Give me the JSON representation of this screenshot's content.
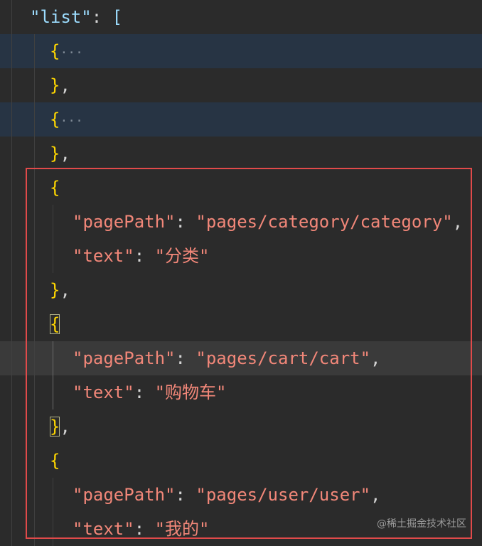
{
  "lines": {
    "l0": {
      "key": "\"list\"",
      "colon": ": ",
      "bracket": "["
    },
    "l1": {
      "brace": "{",
      "ellipsis": "···"
    },
    "l2": {
      "brace": "}",
      "comma": ","
    },
    "l3": {
      "brace": "{",
      "ellipsis": "···"
    },
    "l4": {
      "brace": "}",
      "comma": ","
    },
    "l5": {
      "brace": "{"
    },
    "l6": {
      "key": "\"pagePath\"",
      "colon": ": ",
      "value": "\"pages/category/category\"",
      "comma": ","
    },
    "l7": {
      "key": "\"text\"",
      "colon": ": ",
      "value": "\"分类\""
    },
    "l8": {
      "brace": "}",
      "comma": ","
    },
    "l9": {
      "brace": "{"
    },
    "l10": {
      "key": "\"pagePath\"",
      "colon": ": ",
      "value": "\"pages/cart/cart\"",
      "comma": ","
    },
    "l11": {
      "key": "\"text\"",
      "colon": ": ",
      "value": "\"购物车\""
    },
    "l12": {
      "brace": "}",
      "comma": ","
    },
    "l13": {
      "brace": "{"
    },
    "l14": {
      "key": "\"pagePath\"",
      "colon": ": ",
      "value": "\"pages/user/user\"",
      "comma": ","
    },
    "l15": {
      "key": "\"text\"",
      "colon": ": ",
      "value": "\"我的\""
    }
  },
  "watermark": "@稀土掘金技术社区"
}
